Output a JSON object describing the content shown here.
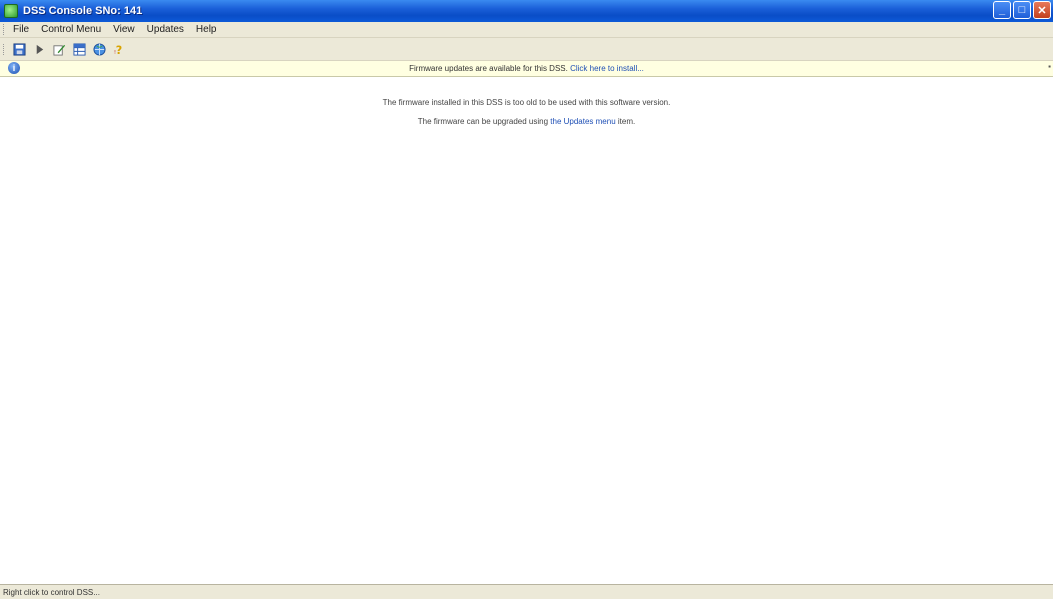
{
  "window": {
    "title": "DSS Console SNo: 141",
    "minimize_label": "_",
    "maximize_label": "□",
    "close_label": "✕"
  },
  "menu": {
    "items": [
      {
        "label": "File"
      },
      {
        "label": "Control Menu"
      },
      {
        "label": "View"
      },
      {
        "label": "Updates"
      },
      {
        "label": "Help"
      }
    ]
  },
  "toolbar": {
    "buttons": [
      {
        "icon": "save-icon"
      },
      {
        "icon": "play-icon"
      },
      {
        "icon": "edit-icon"
      },
      {
        "icon": "grid-icon"
      },
      {
        "icon": "globe-icon"
      },
      {
        "icon": "help-icon"
      }
    ]
  },
  "infobar": {
    "text_before": "Firmware updates are available for this DSS.",
    "link": "Click here to install..."
  },
  "main": {
    "line1": "The firmware installed in this DSS is too old to be used with this software version.",
    "line2_before": "The firmware can be upgraded using",
    "line2_link": "the Updates menu",
    "line2_after": "item."
  },
  "status": {
    "text": "Right click to control DSS..."
  },
  "colors": {
    "titlebar": "#0a4dc7",
    "chrome": "#ece9d8",
    "infobar": "#ffffe1",
    "link": "#1e4fb5"
  }
}
